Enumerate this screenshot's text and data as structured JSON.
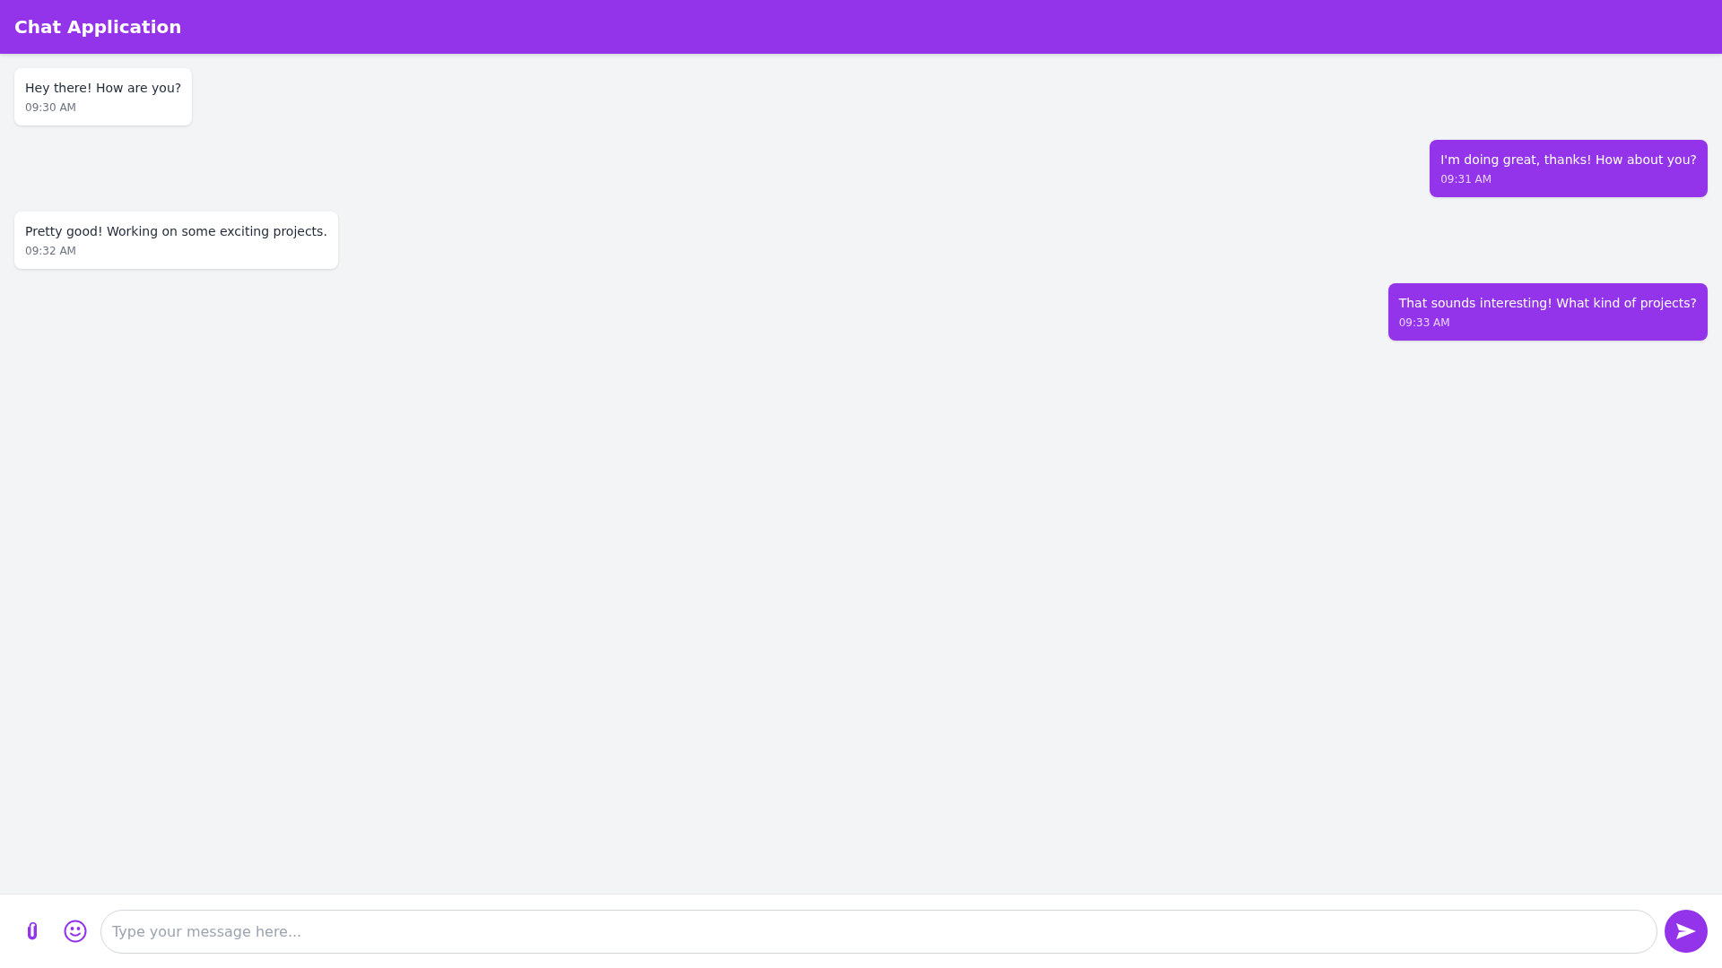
{
  "header": {
    "title": "Chat Application"
  },
  "messages": [
    {
      "kind": "received",
      "text": "Hey there! How are you?",
      "time": "09:30 AM"
    },
    {
      "kind": "sent",
      "text": "I'm doing great, thanks! How about you?",
      "time": "09:31 AM"
    },
    {
      "kind": "received",
      "text": "Pretty good! Working on some exciting projects.",
      "time": "09:32 AM"
    },
    {
      "kind": "sent",
      "text": "That sounds interesting! What kind of projects?",
      "time": "09:33 AM"
    }
  ],
  "composer": {
    "placeholder": "Type your message here..."
  }
}
